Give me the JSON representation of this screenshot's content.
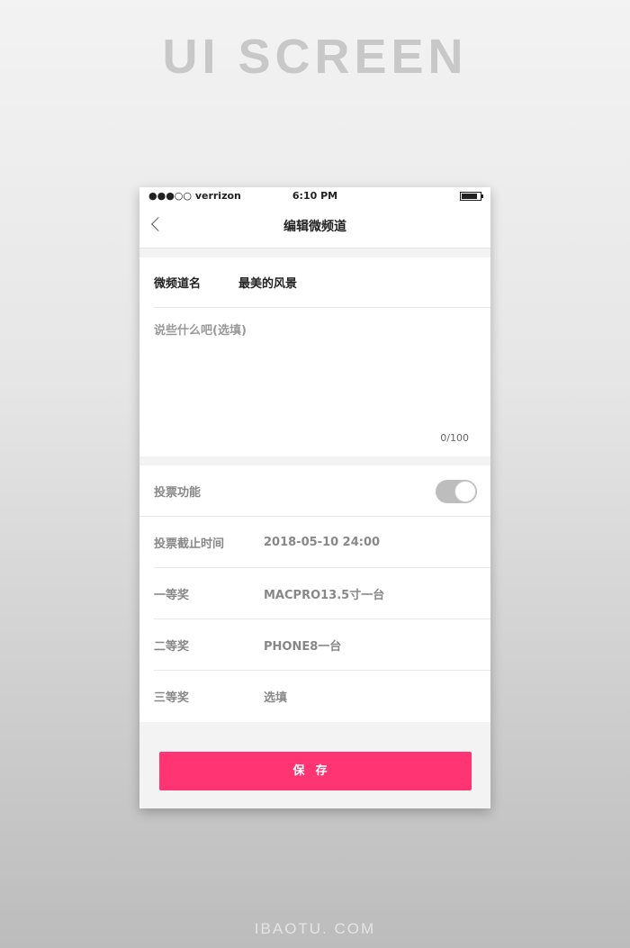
{
  "hero_title": "UI SCREEN",
  "footer": "IBAOTU. COM",
  "status": {
    "carrier": "●●●○○ verrizon",
    "time": "6:10  PM",
    "battery": "full"
  },
  "nav": {
    "title": "编辑微频道",
    "back_icon": "chevron-left"
  },
  "name_field": {
    "label": "微频道名",
    "value": "最美的风景"
  },
  "description": {
    "placeholder": "说些什么吧(选填)",
    "counter": "0/100"
  },
  "vote": {
    "label": "投票功能",
    "enabled": false
  },
  "rows": [
    {
      "label": "投票截止时间",
      "value": "2018-05-10 24:00"
    },
    {
      "label": "一等奖",
      "value": "MACPRO13.5寸一台"
    },
    {
      "label": "二等奖",
      "value": "PHONE8一台"
    },
    {
      "label": "三等奖",
      "value": "选填"
    }
  ],
  "save_label": "保存",
  "colors": {
    "accent": "#fe3572"
  }
}
